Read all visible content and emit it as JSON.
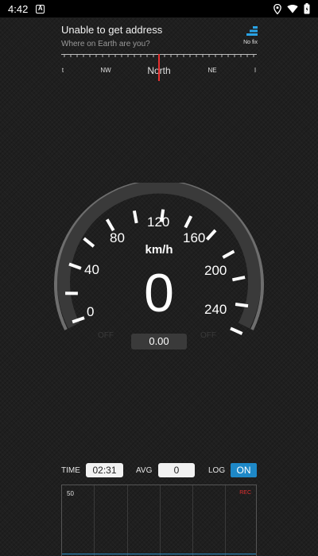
{
  "status_bar": {
    "time": "4:42",
    "notification_icon": "A",
    "icons": [
      "location-icon",
      "wifi-icon",
      "battery-icon"
    ]
  },
  "address": {
    "title": "Unable to get address",
    "subtitle": "Where on Earth are you?"
  },
  "gps": {
    "label": "No fix",
    "icon": "signal-bars-icon"
  },
  "compass": {
    "labels": [
      "t",
      "NW",
      "North",
      "NE",
      "l"
    ],
    "needle_color": "#e53030"
  },
  "speedometer": {
    "tick_labels": [
      "0",
      "40",
      "80",
      "120",
      "160",
      "200",
      "240"
    ],
    "unit": "km/h",
    "speed": "0",
    "left_indicator": "OFF",
    "right_indicator": "OFF",
    "distance": "0.00"
  },
  "controls": {
    "time_label": "TIME",
    "time_value": "02:31",
    "avg_label": "AVG",
    "avg_value": "0",
    "log_label": "LOG",
    "log_toggle": "ON",
    "accent_color": "#1e88c7"
  },
  "graph": {
    "scale_label": "50",
    "rec_label": "REC",
    "rec_color": "#e03030"
  }
}
